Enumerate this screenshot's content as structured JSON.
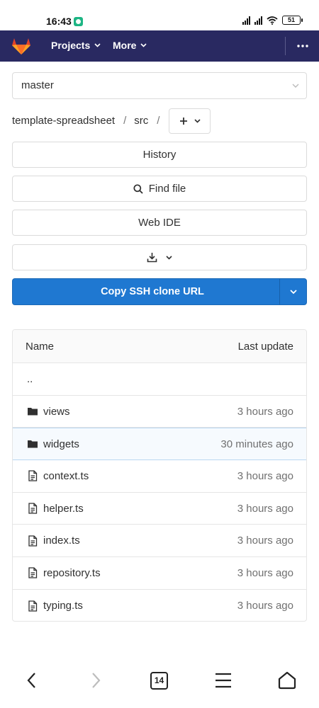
{
  "status_bar": {
    "time": "16:43",
    "battery": "51"
  },
  "navbar": {
    "projects_label": "Projects",
    "more_label": "More",
    "brand_color": "#292961",
    "logo_color": "#e24329"
  },
  "branch_selector": {
    "value": "master"
  },
  "breadcrumb": {
    "repo": "template-spreadsheet",
    "separator": "/",
    "folder": "src"
  },
  "actions": {
    "history_label": "History",
    "find_file_label": "Find file",
    "web_ide_label": "Web IDE",
    "clone_label": "Copy SSH clone URL",
    "clone_color": "#1f78d1"
  },
  "file_table": {
    "columns": [
      "Name",
      "Last update"
    ],
    "rows": [
      {
        "name": "..",
        "type": "parent",
        "time": ""
      },
      {
        "name": "views",
        "type": "folder",
        "time": "3 hours ago"
      },
      {
        "name": "widgets",
        "type": "folder",
        "time": "30 minutes ago"
      },
      {
        "name": "context.ts",
        "type": "file",
        "time": "3 hours ago"
      },
      {
        "name": "helper.ts",
        "type": "file",
        "time": "3 hours ago"
      },
      {
        "name": "index.ts",
        "type": "file",
        "time": "3 hours ago"
      },
      {
        "name": "repository.ts",
        "type": "file",
        "time": "3 hours ago"
      },
      {
        "name": "typing.ts",
        "type": "file",
        "time": "3 hours ago"
      }
    ]
  },
  "browser_bar": {
    "tab_count": "14"
  }
}
